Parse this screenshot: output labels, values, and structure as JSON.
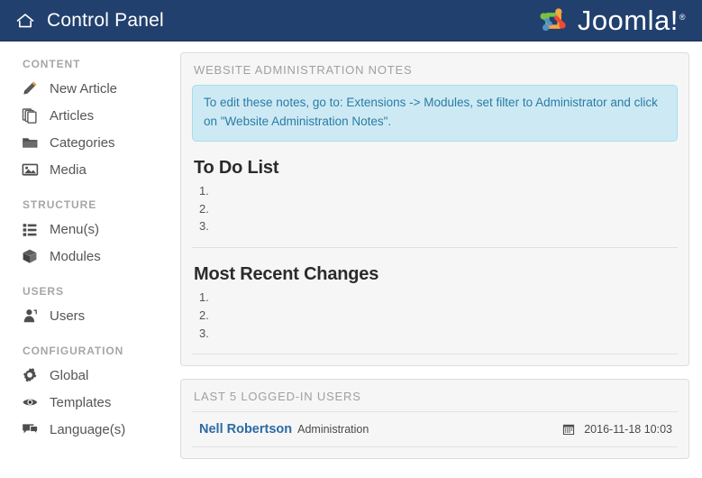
{
  "header": {
    "home_icon": "home-icon",
    "title": "Control Panel",
    "brand_name": "Joomla!",
    "brand_registered": "®",
    "brand_colors": {
      "bar": "#22406e",
      "green": "#7ac143",
      "orange": "#f9a541",
      "blue": "#5091cd",
      "red": "#ee4a35"
    }
  },
  "sidebar": {
    "groups": [
      {
        "title": "CONTENT",
        "items": [
          {
            "label": "New Article",
            "icon": "pencil-icon"
          },
          {
            "label": "Articles",
            "icon": "copy-pages-icon"
          },
          {
            "label": "Categories",
            "icon": "folder-icon"
          },
          {
            "label": "Media",
            "icon": "image-icon"
          }
        ]
      },
      {
        "title": "STRUCTURE",
        "items": [
          {
            "label": "Menu(s)",
            "icon": "list-icon"
          },
          {
            "label": "Modules",
            "icon": "cube-icon"
          }
        ]
      },
      {
        "title": "USERS",
        "items": [
          {
            "label": "Users",
            "icon": "user-icon"
          }
        ]
      },
      {
        "title": "CONFIGURATION",
        "items": [
          {
            "label": "Global",
            "icon": "gear-icon"
          },
          {
            "label": "Templates",
            "icon": "eye-icon"
          },
          {
            "label": "Language(s)",
            "icon": "speech-bubble-icon"
          }
        ]
      }
    ]
  },
  "notes_panel": {
    "title": "WEBSITE ADMINISTRATION NOTES",
    "notice_text": "To edit these notes, go to: Extensions -> Modules, set filter to Administrator and click on \"Website Administration Notes\".",
    "notice_bg": "#cdeaf4",
    "notice_color": "#2b7ba5",
    "todo": {
      "heading": "To Do List",
      "items": [
        "1.",
        "2.",
        "3."
      ]
    },
    "recent": {
      "heading": "Most Recent Changes",
      "items": [
        "1.",
        "2.",
        "3."
      ]
    }
  },
  "users_panel": {
    "title": "LAST 5 LOGGED-IN USERS",
    "rows": [
      {
        "name": "Nell Robertson",
        "role": "Administration",
        "date_icon": "calendar-icon",
        "date": "2016-11-18 10:03"
      }
    ]
  }
}
